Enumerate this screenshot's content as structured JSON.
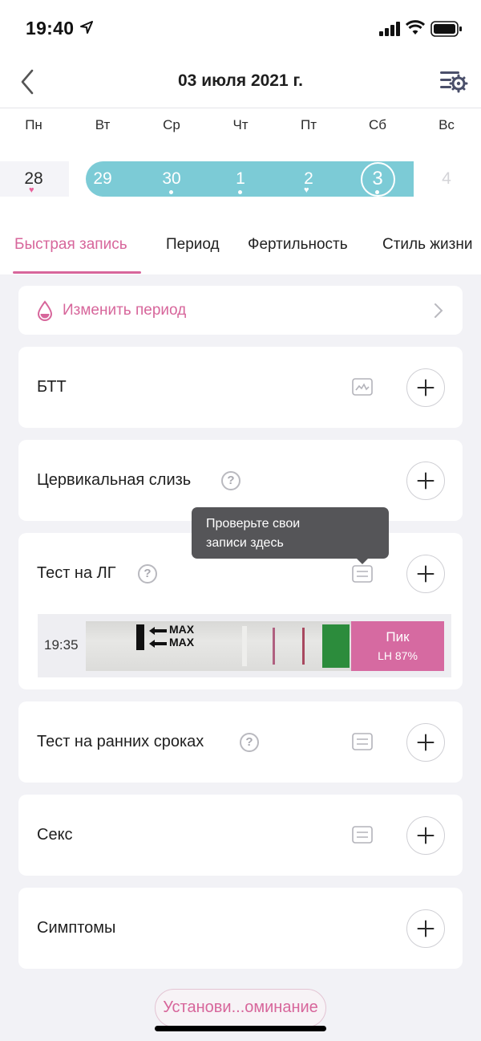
{
  "status_bar": {
    "time": "19:40"
  },
  "header": {
    "title": "03 июля 2021 г."
  },
  "week": {
    "weekdays": [
      "Пн",
      "Вт",
      "Ср",
      "Чт",
      "Пт",
      "Сб",
      "Вс"
    ],
    "days": [
      "28",
      "29",
      "30",
      "1",
      "2",
      "3",
      "4"
    ],
    "selected_day": "3"
  },
  "tabs": [
    "Быстрая запись",
    "Период",
    "Фертильность",
    "Стиль жизни"
  ],
  "change_period": {
    "label": "Изменить период"
  },
  "cards": {
    "btt": {
      "title": "БТТ"
    },
    "cervical": {
      "title": "Цервикальная слизь",
      "help": "?"
    },
    "lh_test": {
      "title": "Тест на ЛГ",
      "help": "?"
    },
    "early_test": {
      "title": "Тест на ранних сроках",
      "help": "?"
    },
    "sex": {
      "title": "Секс"
    },
    "symptoms": {
      "title": "Симптомы"
    }
  },
  "tooltip": {
    "line1": "Проверьте свои",
    "line2": "записи здесь"
  },
  "lh_record": {
    "time": "19:35",
    "strip_text_1": "MAX",
    "strip_text_2": "MAX",
    "result_label": "Пик",
    "result_value": "LH 87%"
  },
  "reminder_button": {
    "label": "Установи...оминание"
  },
  "colors": {
    "accent": "#d7669b",
    "period_band": "#7ccbd6",
    "tooltip_bg": "#555558"
  }
}
